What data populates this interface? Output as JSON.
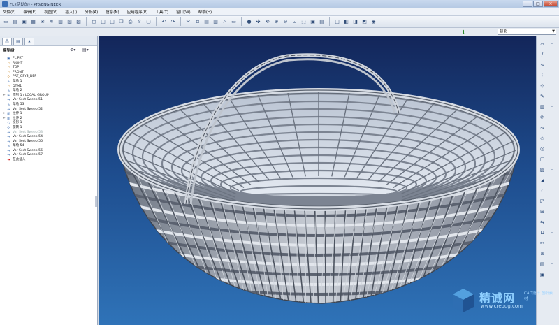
{
  "window": {
    "title": "FL (活动的) - Pro/ENGINEER",
    "minimize": "_",
    "maximize": "□",
    "close": "×"
  },
  "menu": [
    "文件(F)",
    "编辑(E)",
    "视图(V)",
    "插入(I)",
    "分析(A)",
    "信息(N)",
    "应用程序(P)",
    "工具(T)",
    "窗口(W)",
    "帮助(H)"
  ],
  "filter": {
    "value": "智能"
  },
  "model_tree": {
    "header": "模型树",
    "items": [
      {
        "label": "FL.PRT",
        "icon": "part-icon",
        "expand": "",
        "dim": false
      },
      {
        "label": "RIGHT",
        "icon": "datum-plane-icon",
        "expand": "",
        "dim": false
      },
      {
        "label": "TOP",
        "icon": "datum-plane-icon",
        "expand": "",
        "dim": false
      },
      {
        "label": "FRONT",
        "icon": "datum-plane-icon",
        "expand": "",
        "dim": false
      },
      {
        "label": "PRT_CSYS_DEF",
        "icon": "csys-icon",
        "expand": "",
        "dim": false
      },
      {
        "label": "草绘 1",
        "icon": "sketch-icon",
        "expand": "",
        "dim": false
      },
      {
        "label": "DTM1",
        "icon": "datum-plane-icon",
        "expand": "",
        "dim": false
      },
      {
        "label": "草绘 2",
        "icon": "sketch-icon",
        "expand": "",
        "dim": false
      },
      {
        "label": "阵列 1 / LOCAL_GROUP",
        "icon": "pattern-icon",
        "expand": "+",
        "dim": false
      },
      {
        "label": "Var Sect Sweep 51",
        "icon": "sweep-icon",
        "expand": "",
        "dim": false
      },
      {
        "label": "草绘 53",
        "icon": "sketch-icon",
        "expand": "",
        "dim": false
      },
      {
        "label": "Var Sect Sweep 52",
        "icon": "sweep-icon",
        "expand": "",
        "dim": false
      },
      {
        "label": "拉伸 1",
        "icon": "extrude-icon",
        "expand": "+",
        "dim": false
      },
      {
        "label": "拉伸 2",
        "icon": "extrude-icon",
        "expand": "+",
        "dim": false
      },
      {
        "label": "投影 1",
        "icon": "projection-icon",
        "expand": "",
        "dim": false
      },
      {
        "label": "旋转 1",
        "icon": "revolve-icon",
        "expand": "",
        "dim": false
      },
      {
        "label": "Var Sect Sweep 53",
        "icon": "sweep-icon",
        "expand": "",
        "dim": true
      },
      {
        "label": "Var Sect Sweep 54",
        "icon": "sweep-icon",
        "expand": "",
        "dim": false
      },
      {
        "label": "Var Sect Sweep 55",
        "icon": "sweep-icon",
        "expand": "",
        "dim": false
      },
      {
        "label": "草绘 54",
        "icon": "sketch-icon",
        "expand": "",
        "dim": false
      },
      {
        "label": "Var Sect Sweep 56",
        "icon": "sweep-icon",
        "expand": "",
        "dim": false
      },
      {
        "label": "Var Sect Sweep 57",
        "icon": "sweep-icon",
        "expand": "",
        "dim": false
      },
      {
        "label": "在此插入",
        "icon": "insert-here-icon",
        "expand": "",
        "dim": false
      }
    ]
  },
  "watermark": {
    "name": "精诚网",
    "tagline": "CAD设计 图纸素材",
    "url": "www.creoug.com"
  }
}
